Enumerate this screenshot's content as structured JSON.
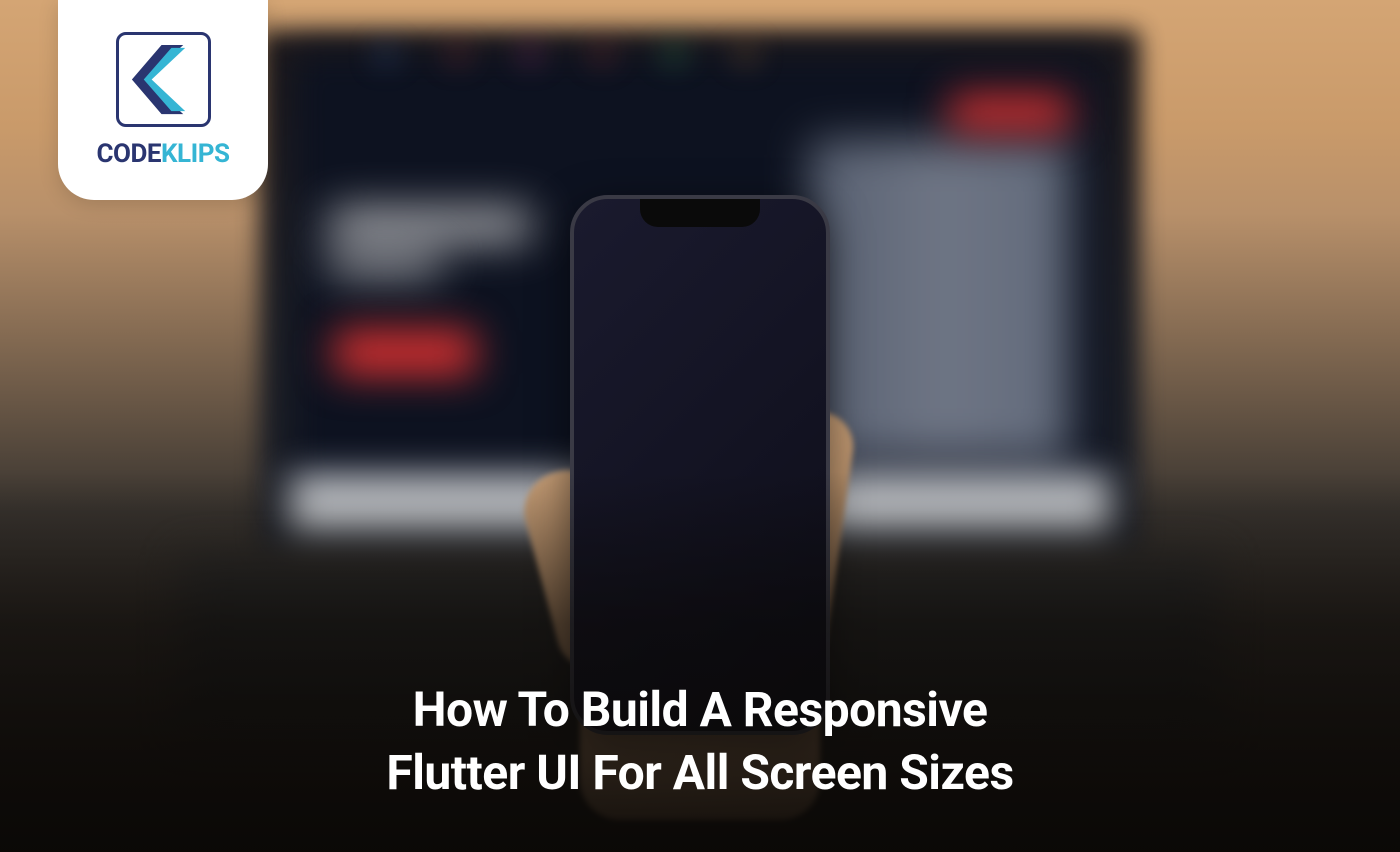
{
  "logo": {
    "brand_part1": "CODE",
    "brand_part2": "KLIPS",
    "icon_name": "codeklips-logo"
  },
  "hero": {
    "title_line1": "How To Build A Responsive",
    "title_line2": "Flutter UI For All Screen Sizes"
  },
  "colors": {
    "logo_primary": "#2a3570",
    "logo_accent": "#35b5d4",
    "title_text": "#ffffff"
  }
}
